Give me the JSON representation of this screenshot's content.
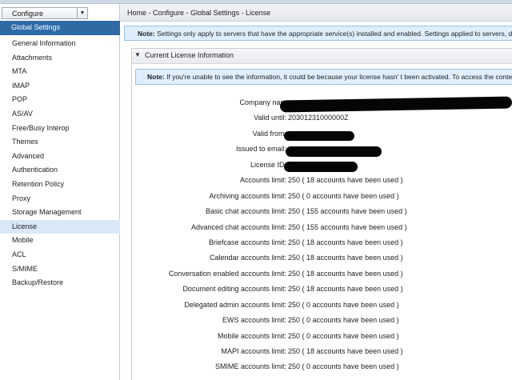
{
  "sidebar": {
    "dropdown_label": "Configure",
    "header": "Global Settings",
    "items": [
      {
        "label": "General Information",
        "active": false
      },
      {
        "label": "Attachments",
        "active": false
      },
      {
        "label": "MTA",
        "active": false
      },
      {
        "label": "IMAP",
        "active": false
      },
      {
        "label": "POP",
        "active": false
      },
      {
        "label": "AS/AV",
        "active": false
      },
      {
        "label": "Free/Busy Interop",
        "active": false
      },
      {
        "label": "Themes",
        "active": false
      },
      {
        "label": "Advanced",
        "active": false
      },
      {
        "label": "Authentication",
        "active": false
      },
      {
        "label": "Retention Policy",
        "active": false
      },
      {
        "label": "Proxy",
        "active": false
      },
      {
        "label": "Storage Management",
        "active": false
      },
      {
        "label": "License",
        "active": true
      },
      {
        "label": "Mobile",
        "active": false
      },
      {
        "label": "ACL",
        "active": false
      },
      {
        "label": "S/MIME",
        "active": false
      },
      {
        "label": "Backup/Restore",
        "active": false
      }
    ]
  },
  "breadcrumb": "Home - Configure - Global Settings - License",
  "note_top": {
    "prefix": "Note:",
    "text": "Settings only apply to servers that have the appropriate service(s) installed and enabled. Settings applied to servers, de"
  },
  "section": {
    "title": "Current License Information",
    "note_prefix": "Note:",
    "note_text": "If you're unable to see the information, it could be because your license hasn' t been activated. To access the conte"
  },
  "license_rows": [
    {
      "key": "Company nam",
      "value": ""
    },
    {
      "key": "Valid until:",
      "value": "20301231000000Z"
    },
    {
      "key": "Valid from:",
      "value": ""
    },
    {
      "key": "Issued to email:",
      "value": ""
    },
    {
      "key": "License ID:",
      "value": ""
    },
    {
      "key": "Accounts limit:",
      "value": "250 ( 18 accounts have been used )"
    },
    {
      "key": "Archiving accounts limit:",
      "value": "250 ( 0 accounts have been used )"
    },
    {
      "key": "Basic chat accounts limit:",
      "value": "250 ( 155 accounts have been used )"
    },
    {
      "key": "Advanced chat accounts limit:",
      "value": "250 ( 155 accounts have been used )"
    },
    {
      "key": "Briefcase accounts limit:",
      "value": "250 ( 18 accounts have been used )"
    },
    {
      "key": "Calendar accounts limit:",
      "value": "250 ( 18 accounts have been used )"
    },
    {
      "key": "Conversation enabled accounts limit:",
      "value": "250 ( 18 accounts have been used )"
    },
    {
      "key": "Document editing accounts limit:",
      "value": "250 ( 18 accounts have been used )"
    },
    {
      "key": "Delegated admin accounts limit:",
      "value": "250 ( 0 accounts have been used )"
    },
    {
      "key": "EWS accounts limit:",
      "value": "250 ( 0 accounts have been used )"
    },
    {
      "key": "Mobile accounts limit:",
      "value": "250 ( 0 accounts have been used )"
    },
    {
      "key": "MAPI accounts limit:",
      "value": "250 ( 18 accounts have been used )"
    },
    {
      "key": "SMIME accounts limit:",
      "value": "250 ( 0 accounts have been used )"
    }
  ]
}
